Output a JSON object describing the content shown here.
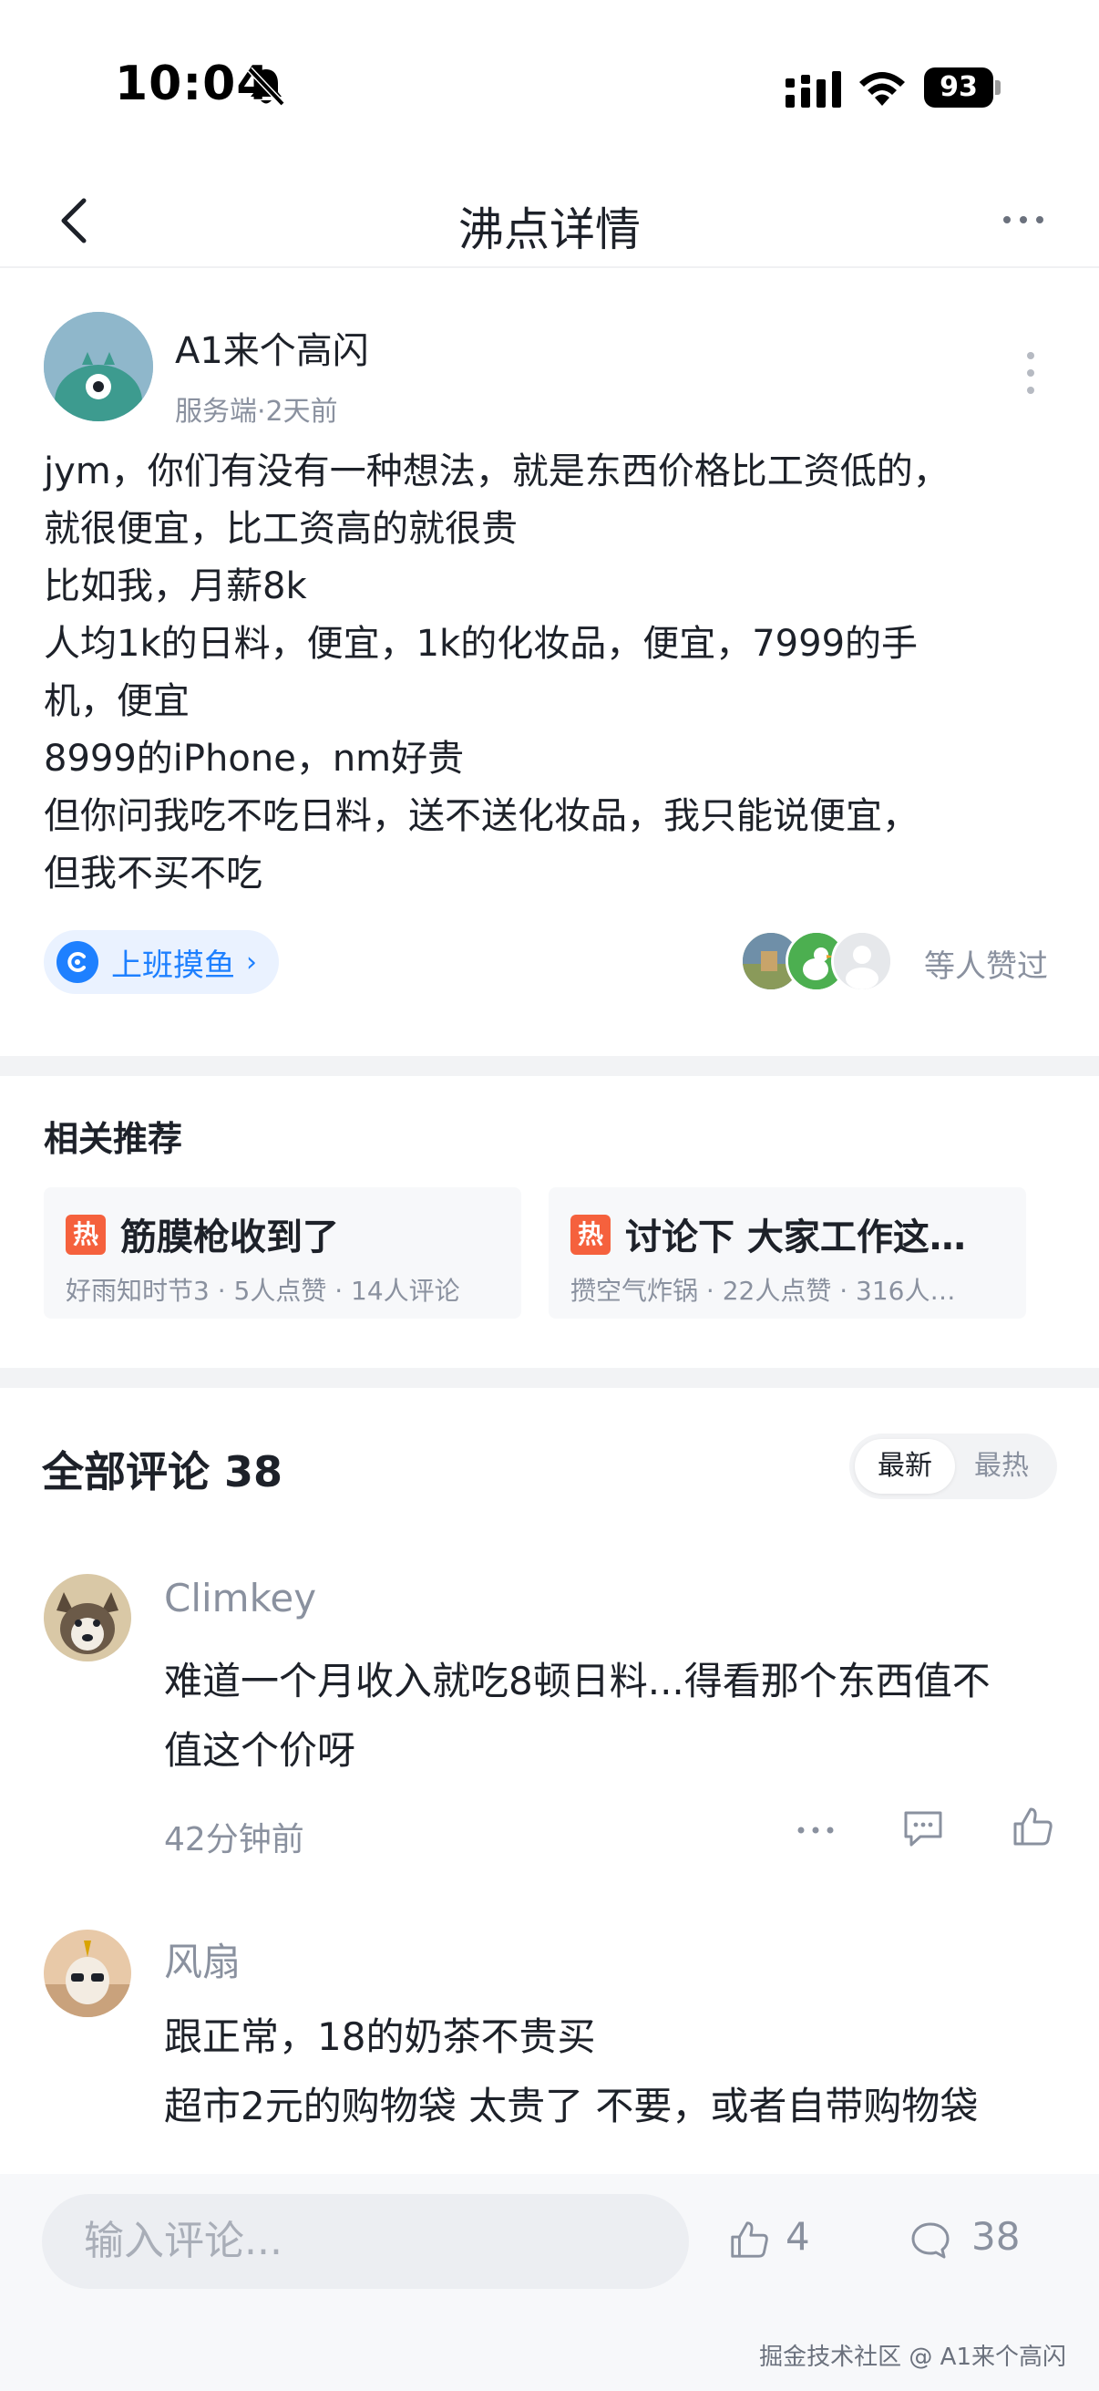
{
  "status_bar": {
    "time": "10:04",
    "battery": "93",
    "icons": [
      "bell-off-icon",
      "signal-icon",
      "wifi-icon",
      "battery-icon"
    ]
  },
  "nav": {
    "title": "沸点详情",
    "back_icon": "chevron-left-icon",
    "more_icon": "more-horizontal-icon"
  },
  "post": {
    "author": "A1来个高闪",
    "meta": "服务端·2天前",
    "lines": [
      "jym，你们有没有一种想法，就是东西价格比工资低的，",
      "就很便宜，比工资高的就很贵",
      "比如我，月薪8k",
      "人均1k的日料，便宜，1k的化妆品，便宜，7999的手",
      "机，便宜",
      "8999的iPhone，nm好贵",
      "但你问我吃不吃日料，送不送化妆品，我只能说便宜，",
      "但我不买不吃"
    ],
    "circle_tag": "上班摸鱼",
    "likers_text": "等人赞过"
  },
  "related": {
    "title": "相关推荐",
    "hot_badge": "热",
    "items": [
      {
        "title": "筋膜枪收到了",
        "meta": "好雨知时节3 · 5人点赞 · 14人评论"
      },
      {
        "title": "讨论下 大家工作这…",
        "meta": "攒空气炸锅 · 22人点赞 · 316人…"
      }
    ]
  },
  "comments": {
    "title": "全部评论 38",
    "sort_latest": "最新",
    "sort_hot": "最热",
    "items": [
      {
        "name": "Climkey",
        "lines": [
          "难道一个月收入就吃8顿日料...得看那个东西值不",
          "值这个价呀"
        ],
        "time": "42分钟前"
      },
      {
        "name": "风扇",
        "lines": [
          "跟正常，18的奶茶不贵买",
          "超市2元的购物袋 太贵了 不要，或者自带购物袋"
        ],
        "time": ""
      }
    ]
  },
  "bottom_bar": {
    "input_placeholder": "输入评论...",
    "like_count": "4",
    "comment_count": "38"
  },
  "watermark": "掘金技术社区 @ A1来个高闪",
  "colors": {
    "accent": "#1e80ff",
    "hot": "#f5613d",
    "text_primary": "#1d2129",
    "text_secondary": "#8a919f"
  }
}
